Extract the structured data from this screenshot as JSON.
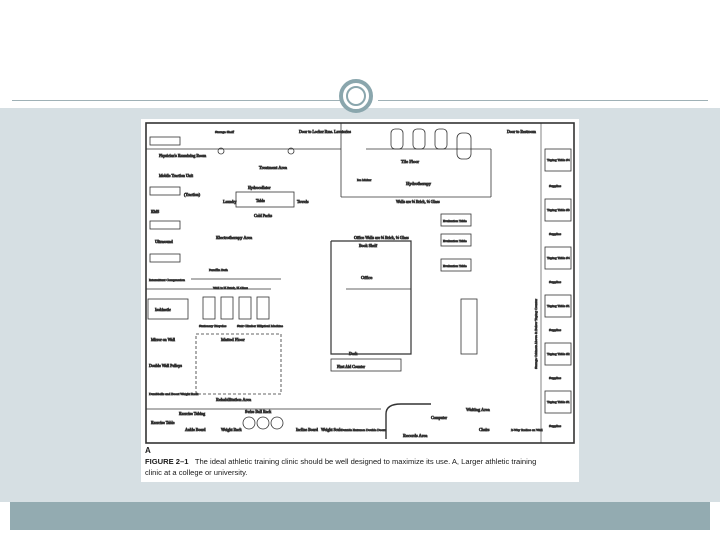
{
  "figure": {
    "letter": "A",
    "caption_label": "FIGURE 2–1",
    "caption_line1": "The ideal athletic training clinic should be well designed to maximize its use. A, Larger athletic training",
    "caption_line2": "clinic at a college or university."
  },
  "plan": {
    "rooms": {
      "treatment_area": "Treatment Area",
      "hydrotherapy": "Hydrotherapy",
      "tile_floor": "Tile Floor",
      "electrotherapy_area": "Electrotherapy Area",
      "rehab_area": "Rehabilitation Area",
      "matted_floor": "Matted Floor",
      "office": "Office",
      "records_area": "Records Area",
      "waiting_area": "Waiting Area",
      "first_aid_counter": "First Aid Counter",
      "taping_area": "Storage Cabinets Above & Below Taping Counter"
    },
    "labels": {
      "sink": "Sink",
      "icemaker": "Ice Maker",
      "storage_shelf": "Storage Shelf",
      "door_locker": "Door to Locker Rms. Lavatories",
      "door_restroom": "Door to Restroom",
      "stool": "Stool",
      "treatment_table": "Treatment Table",
      "physicians_exam": "Physician's Examining Room",
      "mobile_traction": "Mobile Traction Unit",
      "traction": "(Traction)",
      "ems": "EMS",
      "ultrasound": "Ultrasound",
      "intermittent_compression": "Intermittent Compression",
      "isokinetic": "Isokinetic",
      "mirror": "Mirror on Wall",
      "double_wall_pulleys": "Double Wall Pulleys",
      "dumbbells": "Dumbbells and Boost Weight Rack",
      "exercise_table": "Exercise Table",
      "exercise_tubing": "Exercise Tubing",
      "ankle_board": "Ankle Board",
      "weight_rack": "Weight Rack",
      "swiss_ball_rack": "Swiss Ball Rack",
      "incline_board": "Incline Board",
      "weight_scale": "Weight Scale",
      "outside_entrance": "Outside Entrance Double Doors",
      "counter": "Counter",
      "computer": "Computer",
      "table": "Table",
      "lock_files": "Lock Files",
      "chairs": "Chairs",
      "two_way_radios": "2-Way Radios on Wall",
      "whirlpool": "WP",
      "laundry": "Laundry",
      "towels": "Towels",
      "cold_packs": "Cold Packs",
      "hydrocollator": "Hydrocollator",
      "hydro_table": "Table",
      "walls_hydro": "Walls are ½ Brick, ½ Glass",
      "evaluation_table": "Evaluation Table",
      "office_walls": "Office Walls are ½ Brick, ½ Glass",
      "book_shelf": "Book Shelf",
      "storage_closet": "Storage Closet",
      "desk": "Desk",
      "computer_office": "Computer",
      "file_cabinet": "File Cabinet",
      "paraffin_bath": "Paraffin Bath",
      "wall_electro": "Wall is ½ Brick, ½ Glass",
      "stationary_bicycles": "Stationary Bicycles",
      "stair_climber": "Stair Climber",
      "elliptical": "Elliptical Machine",
      "taping_table": "Taping Table",
      "supplies": "Supplies",
      "sink_small": "Sink"
    },
    "taping_tables": [
      "Taping Table #4",
      "Taping Table #3",
      "Taping Table #4",
      "Taping Table #1",
      "Taping Table #2",
      "Taping Table #1"
    ]
  }
}
